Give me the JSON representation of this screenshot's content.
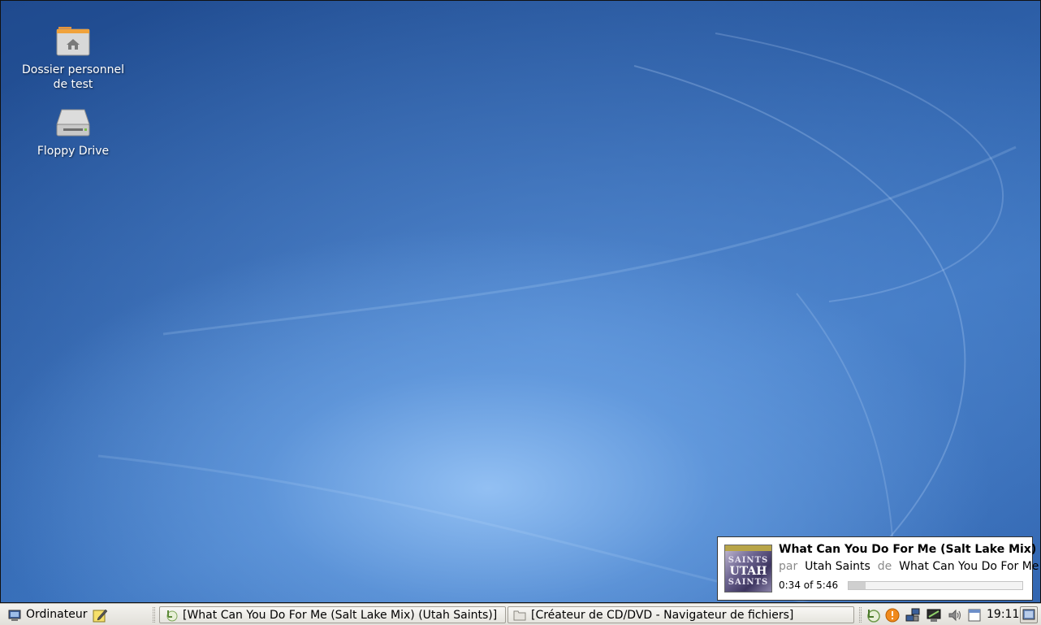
{
  "desktop": {
    "icons": [
      {
        "label_line1": "Dossier personnel",
        "label_line2": "de test",
        "icon": "home-folder-icon"
      },
      {
        "label_line1": "Floppy Drive",
        "label_line2": "",
        "icon": "floppy-drive-icon"
      }
    ],
    "background_colors": [
      "#1f4a8e",
      "#3a72bd",
      "#96c3f5"
    ]
  },
  "notification": {
    "title": "What Can You Do For Me (Salt Lake Mix)",
    "by_prefix": "par",
    "artist": "Utah Saints",
    "from_prefix": "de",
    "album": "What Can You Do For Me",
    "time": "0:34 of 5:46",
    "progress_fraction": 0.098,
    "cover": {
      "top_text": "SAINTS",
      "main_text": "UTAH",
      "bottom_text": "SAINTS"
    }
  },
  "taskbar": {
    "menu_label": "Ordinateur",
    "menu_icon": "computer-icon",
    "launcher_icon": "notes-edit-icon",
    "tasks": [
      {
        "label": "[What Can You Do For Me (Salt Lake Mix) (Utah Saints)]",
        "icon": "music-player-icon"
      },
      {
        "label": "[Créateur de CD/DVD - Navigateur de fichiers]",
        "icon": "folder-icon"
      }
    ],
    "tray_icons": [
      "music-player-tray-icon",
      "update-alert-icon",
      "network-icon",
      "display-icon",
      "volume-icon",
      "calendar-icon"
    ],
    "clock": "19:11",
    "show_desktop_icon": "show-desktop-icon"
  }
}
